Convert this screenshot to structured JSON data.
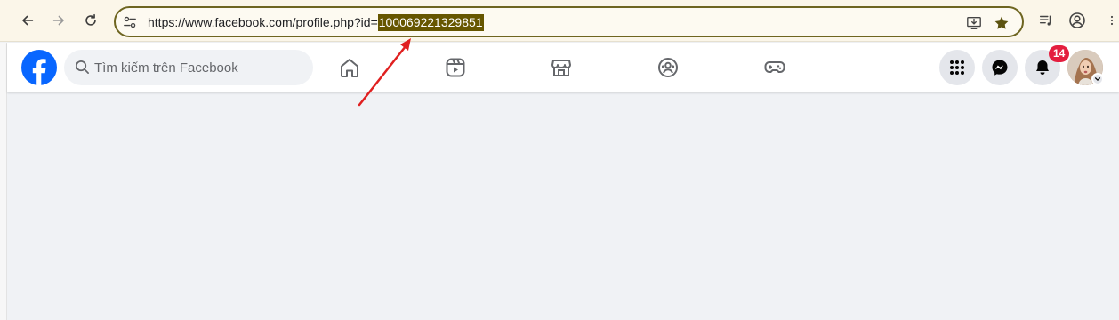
{
  "browser": {
    "url_prefix": "https://www.facebook.com/profile.php?id=",
    "url_highlight": "100069221329851"
  },
  "facebook": {
    "search_placeholder": "Tìm kiếm trên Facebook",
    "notification_count": "14"
  },
  "colors": {
    "fb_blue": "#0866ff",
    "badge_red": "#e41e3f",
    "highlight": "#665600",
    "annotation_arrow": "#e02020"
  }
}
